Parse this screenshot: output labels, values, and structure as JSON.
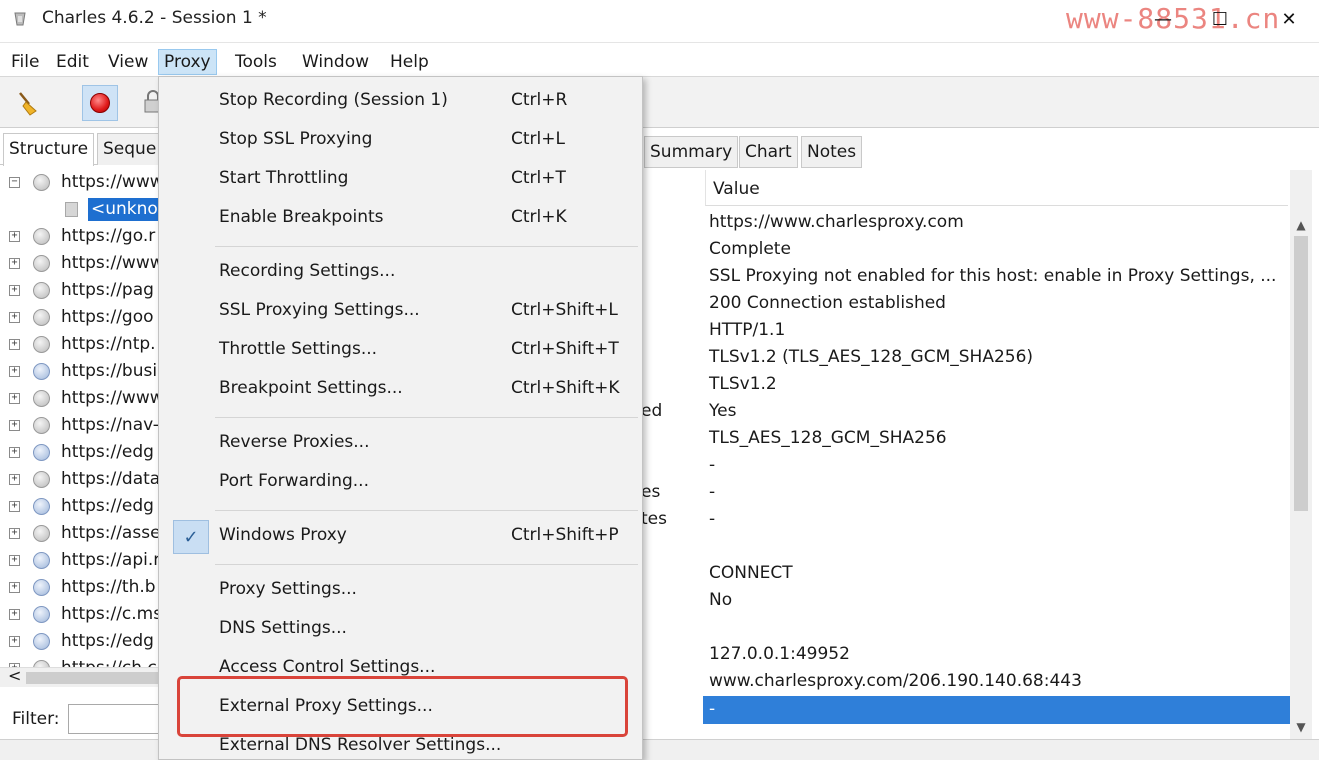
{
  "window": {
    "title": "Charles 4.6.2 - Session 1 *",
    "watermark": "www-88531.cn",
    "minimize": "—",
    "maximize": "☐",
    "close": "✕"
  },
  "menubar": {
    "items": [
      "File",
      "Edit",
      "View",
      "Proxy",
      "Tools",
      "Window",
      "Help"
    ],
    "active": "Proxy"
  },
  "left": {
    "tabs": [
      "Structure",
      "Seque"
    ],
    "tree": [
      {
        "label": "https://www",
        "expander": "−",
        "icon": "gray"
      },
      {
        "label": "<unkno",
        "child": true
      },
      {
        "label": "https://go.r",
        "expander": "+",
        "icon": "gray"
      },
      {
        "label": "https://www",
        "expander": "+",
        "icon": "gray"
      },
      {
        "label": "https://pag",
        "expander": "+",
        "icon": "gray"
      },
      {
        "label": "https://goo",
        "expander": "+",
        "icon": "gray"
      },
      {
        "label": "https://ntp.",
        "expander": "+",
        "icon": "gray"
      },
      {
        "label": "https://busi",
        "expander": "+",
        "icon": "blue"
      },
      {
        "label": "https://www",
        "expander": "+",
        "icon": "gray"
      },
      {
        "label": "https://nav-",
        "expander": "+",
        "icon": "gray"
      },
      {
        "label": "https://edg",
        "expander": "+",
        "icon": "blue"
      },
      {
        "label": "https://data",
        "expander": "+",
        "icon": "gray"
      },
      {
        "label": "https://edg",
        "expander": "+",
        "icon": "blue"
      },
      {
        "label": "https://asse",
        "expander": "+",
        "icon": "gray"
      },
      {
        "label": "https://api.r",
        "expander": "+",
        "icon": "blue"
      },
      {
        "label": "https://th.b",
        "expander": "+",
        "icon": "blue"
      },
      {
        "label": "https://c.ms",
        "expander": "+",
        "icon": "blue"
      },
      {
        "label": "https://edg",
        "expander": "+",
        "icon": "blue"
      },
      {
        "label": "https://ch.c",
        "expander": "+",
        "icon": "gray"
      }
    ],
    "scroll_left": "<",
    "filter_label": "Filter:",
    "filter_value": ""
  },
  "right": {
    "tabs": [
      "Summary",
      "Chart",
      "Notes"
    ],
    "value_header": "Value",
    "name_fragments": [
      {
        "text": "ed",
        "row": 7
      },
      {
        "text": "es",
        "row": 10
      },
      {
        "text": "tes",
        "row": 11
      }
    ],
    "values": [
      "https://www.charlesproxy.com",
      "Complete",
      "SSL Proxying not enabled for this host: enable in Proxy Settings, ...",
      "200 Connection established",
      "HTTP/1.1",
      "TLSv1.2 (TLS_AES_128_GCM_SHA256)",
      "TLSv1.2",
      "Yes",
      "TLS_AES_128_GCM_SHA256",
      "-",
      "-",
      "-",
      "",
      "CONNECT",
      "No",
      "",
      "127.0.0.1:49952",
      "www.charlesproxy.com/206.190.140.68:443"
    ],
    "selected_value": "-",
    "scroll_up": "▲",
    "scroll_down": "▼"
  },
  "proxy_menu": {
    "groups": [
      [
        {
          "label": "Stop Recording (Session 1)",
          "shortcut": "Ctrl+R"
        },
        {
          "label": "Stop SSL Proxying",
          "shortcut": "Ctrl+L"
        },
        {
          "label": "Start Throttling",
          "shortcut": "Ctrl+T"
        },
        {
          "label": "Enable Breakpoints",
          "shortcut": "Ctrl+K"
        }
      ],
      [
        {
          "label": "Recording Settings...",
          "shortcut": ""
        },
        {
          "label": "SSL Proxying Settings...",
          "shortcut": "Ctrl+Shift+L"
        },
        {
          "label": "Throttle Settings...",
          "shortcut": "Ctrl+Shift+T"
        },
        {
          "label": "Breakpoint Settings...",
          "shortcut": "Ctrl+Shift+K"
        }
      ],
      [
        {
          "label": "Reverse Proxies...",
          "shortcut": ""
        },
        {
          "label": "Port Forwarding...",
          "shortcut": ""
        }
      ],
      [
        {
          "label": "Windows Proxy",
          "shortcut": "Ctrl+Shift+P",
          "checked": true
        }
      ],
      [
        {
          "label": "Proxy Settings...",
          "shortcut": ""
        },
        {
          "label": "DNS Settings...",
          "shortcut": ""
        },
        {
          "label": "Access Control Settings...",
          "shortcut": ""
        },
        {
          "label": "External Proxy Settings...",
          "shortcut": "",
          "highlighted": true
        },
        {
          "label": "External DNS Resolver Settings...",
          "shortcut": ""
        }
      ]
    ],
    "check_mark": "✓"
  },
  "colors": {
    "highlight_border": "#d9443a",
    "selection": "#2f7fd9",
    "menu_active": "#cce4f7"
  }
}
